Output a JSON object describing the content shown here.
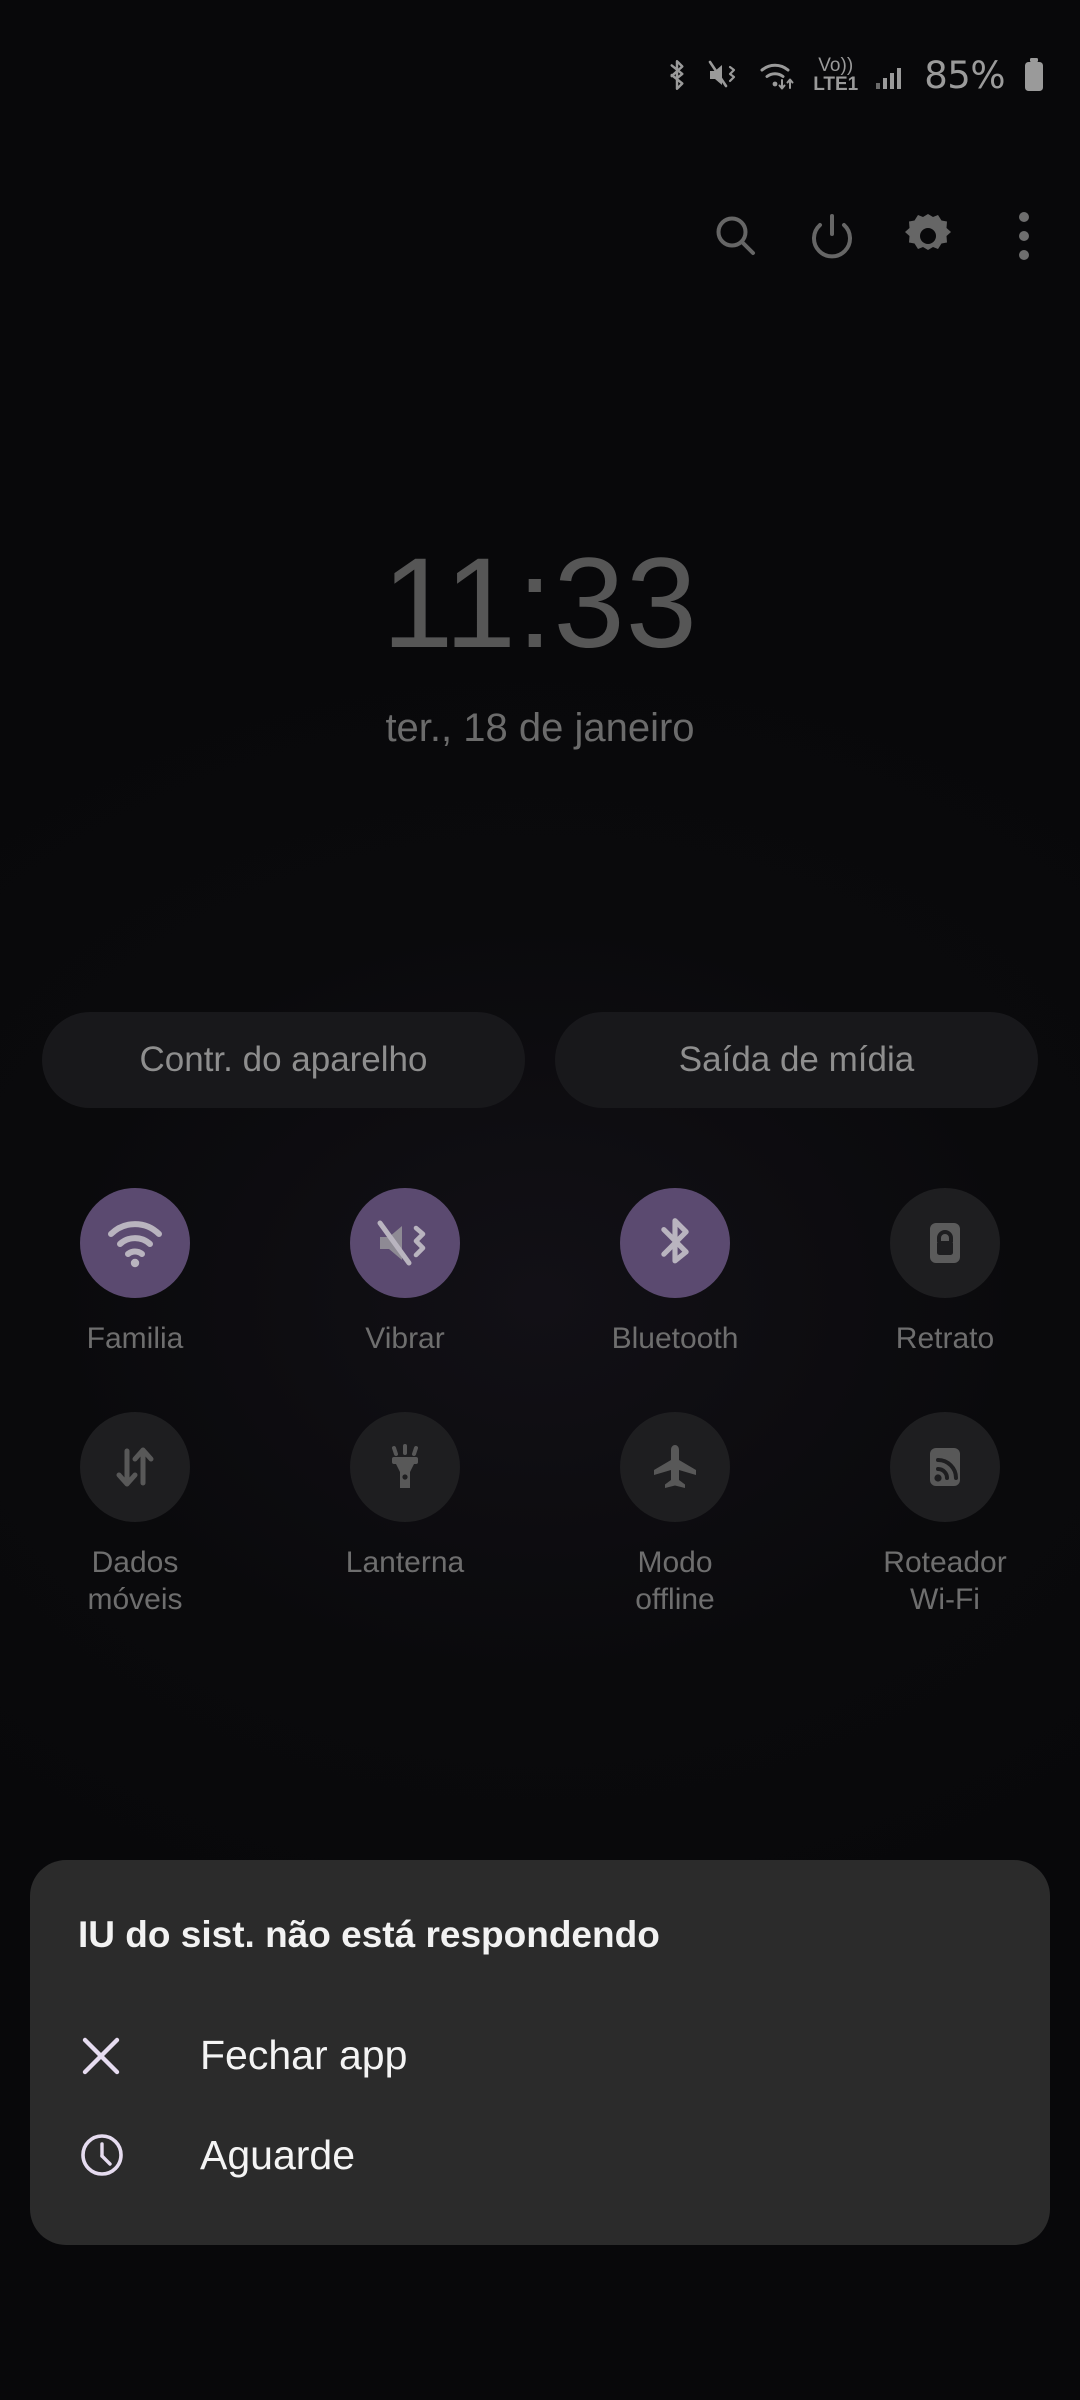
{
  "statusbar": {
    "icons": [
      {
        "name": "bluetooth-icon",
        "label": "Bluetooth"
      },
      {
        "name": "mute-vibrate-icon",
        "label": "Silencioso com vibração"
      },
      {
        "name": "wifi-data-icon",
        "label": "Wi-Fi"
      },
      {
        "name": "volte-lte1-icon",
        "label": "VoLTE1"
      },
      {
        "name": "cellular-signal-icon",
        "label": "Sinal"
      }
    ],
    "volte_top": "Vo))",
    "volte_bottom": "LTE1",
    "battery_percent": "85%"
  },
  "toolbar": {
    "search_label": "Pesquisar",
    "power_label": "Desligar",
    "settings_label": "Configurações",
    "more_label": "Mais opções"
  },
  "lockinfo": {
    "time": "11:33",
    "date": "ter., 18 de janeiro"
  },
  "pills": [
    {
      "label": "Contr. do aparelho",
      "name": "device-controls-pill"
    },
    {
      "label": "Saída de mídia",
      "name": "media-output-pill"
    }
  ],
  "quick_settings": {
    "rows": [
      [
        {
          "label": "Familia",
          "icon": "wifi-icon",
          "state": "on"
        },
        {
          "label": "Vibrar",
          "icon": "vibrate-icon",
          "state": "on"
        },
        {
          "label": "Bluetooth",
          "icon": "bluetooth-icon",
          "state": "on"
        },
        {
          "label": "Retrato",
          "icon": "rotation-lock-icon",
          "state": "off"
        }
      ],
      [
        {
          "label": "Dados\nmóveis",
          "icon": "mobile-data-icon",
          "state": "off"
        },
        {
          "label": "Lanterna",
          "icon": "flashlight-icon",
          "state": "off"
        },
        {
          "label": "Modo\noffline",
          "icon": "airplane-icon",
          "state": "off"
        },
        {
          "label": "Roteador\nWi-Fi",
          "icon": "hotspot-icon",
          "state": "off"
        }
      ]
    ]
  },
  "dialog": {
    "title": "IU do sist. não está respondendo",
    "options": [
      {
        "label": "Fechar app",
        "icon": "close-icon"
      },
      {
        "label": "Aguarde",
        "icon": "clock-icon"
      }
    ]
  },
  "colors": {
    "background": "#08080a",
    "accent_on": "#5b4a70",
    "toggle_off": "#1e1e20",
    "dialog_bg": "#2b2b2b",
    "dialog_icon": "#e6dcf0",
    "muted_text": "#6e6e6e"
  }
}
